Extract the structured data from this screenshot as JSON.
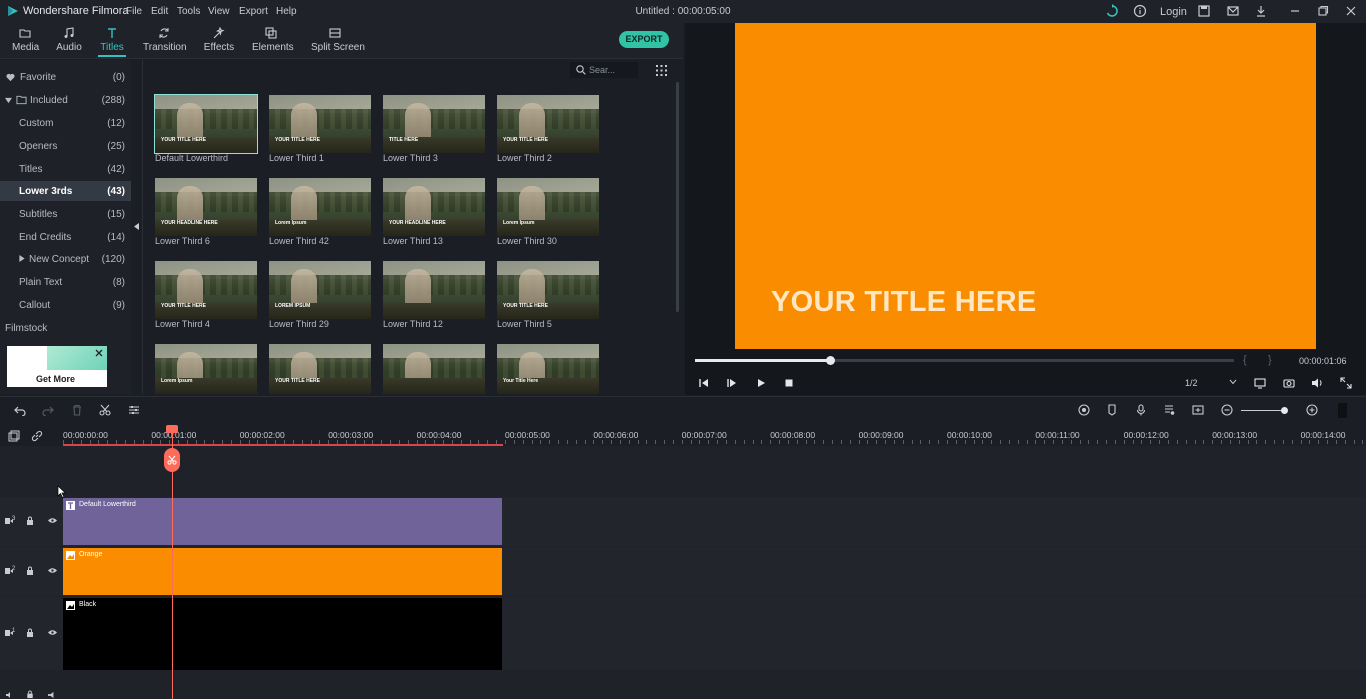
{
  "app": {
    "name": "Wondershare Filmora",
    "doc_title": "Untitled : 00:00:05:00",
    "login_label": "Login"
  },
  "menu": [
    "File",
    "Edit",
    "Tools",
    "View",
    "Export",
    "Help"
  ],
  "toolbar": {
    "tabs": [
      {
        "label": "Media",
        "icon": "folder-icon"
      },
      {
        "label": "Audio",
        "icon": "music-note-icon"
      },
      {
        "label": "Titles",
        "icon": "text-t-icon"
      },
      {
        "label": "Transition",
        "icon": "transition-icon"
      },
      {
        "label": "Effects",
        "icon": "effects-icon"
      },
      {
        "label": "Elements",
        "icon": "elements-icon"
      },
      {
        "label": "Split Screen",
        "icon": "split-screen-icon"
      }
    ],
    "active_tab": "Titles",
    "export_label": "EXPORT"
  },
  "sidebar": {
    "items": [
      {
        "label": "Favorite",
        "count": "(0)"
      },
      {
        "label": "Included",
        "count": "(288)"
      },
      {
        "label": "Custom",
        "count": "(12)"
      },
      {
        "label": "Openers",
        "count": "(25)"
      },
      {
        "label": "Titles",
        "count": "(42)"
      },
      {
        "label": "Lower 3rds",
        "count": "(43)"
      },
      {
        "label": "Subtitles",
        "count": "(15)"
      },
      {
        "label": "End Credits",
        "count": "(14)"
      },
      {
        "label": "New Concept",
        "count": "(120)"
      },
      {
        "label": "Plain Text",
        "count": "(8)"
      },
      {
        "label": "Callout",
        "count": "(9)"
      }
    ],
    "filmstock_label": "Filmstock",
    "get_more_label": "Get More"
  },
  "content": {
    "search_placeholder": "Sear...",
    "thumbnails": [
      {
        "label": "Default Lowerthird",
        "caption": "YOUR TITLE HERE"
      },
      {
        "label": "Lower Third 1",
        "caption": "YOUR TITLE HERE"
      },
      {
        "label": "Lower Third 3",
        "caption": "TITLE HERE"
      },
      {
        "label": "Lower Third 2",
        "caption": "YOUR TITLE HERE"
      },
      {
        "label": "Lower Third 6",
        "caption": "YOUR HEADLINE HERE"
      },
      {
        "label": "Lower Third 42",
        "caption": "Lorem Ipsum"
      },
      {
        "label": "Lower Third 13",
        "caption": "YOUR HEADLINE HERE"
      },
      {
        "label": "Lower Third 30",
        "caption": "Lorem Ipsum"
      },
      {
        "label": "Lower Third 4",
        "caption": "YOUR TITLE HERE"
      },
      {
        "label": "Lower Third 29",
        "caption": "LOREM IPSUM"
      },
      {
        "label": "Lower Third 12",
        "caption": ""
      },
      {
        "label": "Lower Third 5",
        "caption": "YOUR TITLE HERE"
      },
      {
        "label": "",
        "caption": "Lorem Ipsum"
      },
      {
        "label": "",
        "caption": "YOUR TITLE HERE"
      },
      {
        "label": "",
        "caption": ""
      },
      {
        "label": "",
        "caption": "Your Title Here"
      }
    ]
  },
  "preview": {
    "title_text": "YOUR TITLE HERE",
    "timecode": "00:00:01:06",
    "progress": 0.25,
    "quality": "1/2",
    "frame_color": "#fa8c00"
  },
  "timeline": {
    "ruler_labels": [
      "00:00:00:00",
      "00:00:01:00",
      "00:00:02:00",
      "00:00:03:00",
      "00:00:04:00",
      "00:00:05:00",
      "00:00:06:00",
      "00:00:07:00",
      "00:00:08:00",
      "00:00:09:00",
      "00:00:10:00",
      "00:00:11:00",
      "00:00:12:00",
      "00:00:13:00",
      "00:00:14:00"
    ],
    "tracks": [
      {
        "name": "Default Lowerthird",
        "color": "#6f639a",
        "track_number": "3"
      },
      {
        "name": "Orange",
        "color": "#fa8c00",
        "track_number": "2"
      },
      {
        "name": "Black",
        "color": "#000000",
        "track_number": "1"
      }
    ]
  }
}
